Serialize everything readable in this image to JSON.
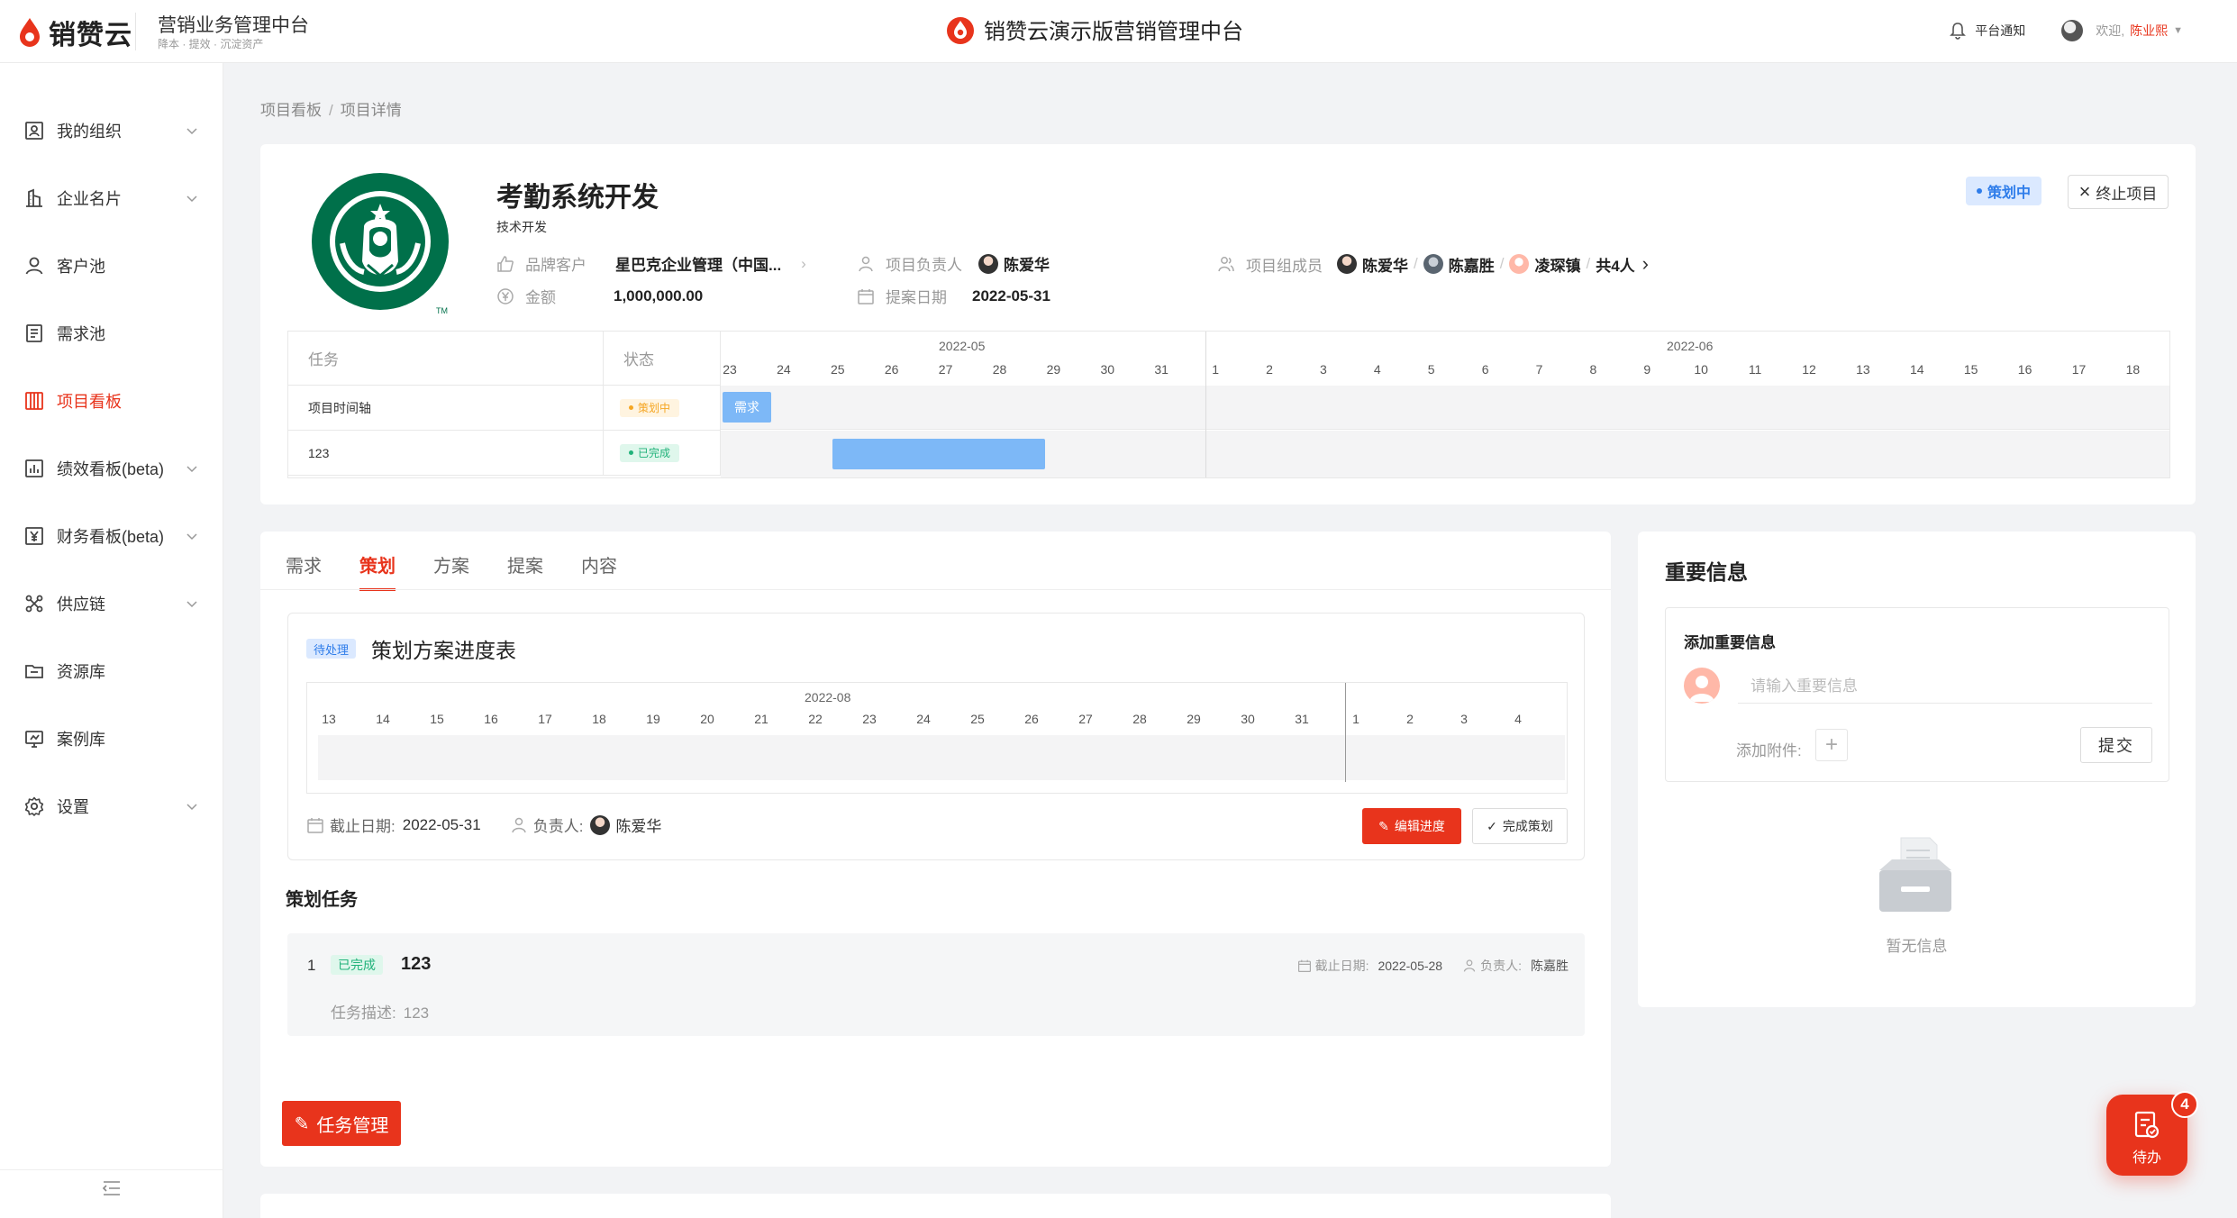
{
  "header": {
    "logo_text": "销赞云",
    "system_title": "营销业务管理中台",
    "system_subtitle": "降本 · 提效 · 沉淀资产",
    "center_title": "销赞云演示版营销管理中台",
    "notify_label": "平台通知",
    "welcome": "欢迎,",
    "user_name": "陈业熙"
  },
  "sidebar": {
    "items": [
      {
        "label": "我的组织",
        "icon": "org-icon",
        "chevron": true
      },
      {
        "label": "企业名片",
        "icon": "building-icon",
        "chevron": true
      },
      {
        "label": "客户池",
        "icon": "user-icon",
        "chevron": false
      },
      {
        "label": "需求池",
        "icon": "doc-icon",
        "chevron": false
      },
      {
        "label": "项目看板",
        "icon": "board-icon",
        "chevron": false,
        "active": true
      },
      {
        "label": "绩效看板(beta)",
        "icon": "chart-icon",
        "chevron": true
      },
      {
        "label": "财务看板(beta)",
        "icon": "yen-icon",
        "chevron": true
      },
      {
        "label": "供应链",
        "icon": "network-icon",
        "chevron": true
      },
      {
        "label": "资源库",
        "icon": "folder-icon",
        "chevron": false
      },
      {
        "label": "案例库",
        "icon": "screen-icon",
        "chevron": false
      },
      {
        "label": "设置",
        "icon": "gear-icon",
        "chevron": true
      }
    ]
  },
  "breadcrumb": {
    "items": [
      "项目看板",
      "项目详情"
    ],
    "separator": "/"
  },
  "project": {
    "name": "考勤系统开发",
    "category": "技术开发",
    "status": "策划中",
    "stop_label": "终止项目",
    "brand_label": "品牌客户",
    "brand_value": "星巴克企业管理（中国...",
    "amount_label": "金额",
    "amount_value": "1,000,000.00",
    "owner_label": "项目负责人",
    "owner_value": "陈爱华",
    "date_label": "提案日期",
    "date_value": "2022-05-31",
    "members_label": "项目组成员",
    "members": [
      "陈爱华",
      "陈嘉胜",
      "凌琛镇"
    ],
    "members_total": "共4人"
  },
  "gantt": {
    "col_task": "任务",
    "col_status": "状态",
    "months": [
      "2022-05",
      "2022-06"
    ],
    "days": [
      "23",
      "24",
      "25",
      "26",
      "27",
      "28",
      "29",
      "30",
      "31",
      "1",
      "2",
      "3",
      "4",
      "5",
      "6",
      "7",
      "8",
      "9",
      "10",
      "11",
      "12",
      "13",
      "14",
      "15",
      "16",
      "17",
      "18"
    ],
    "rows": [
      {
        "task": "项目时间轴",
        "status": "策划中",
        "status_type": "orange",
        "bar_label": "需求"
      },
      {
        "task": "123",
        "status": "已完成",
        "status_type": "green"
      }
    ]
  },
  "tabs": [
    "需求",
    "策划",
    "方案",
    "提案",
    "内容"
  ],
  "plan": {
    "badge": "待处理",
    "title": "策划方案进度表",
    "month": "2022-08",
    "days": [
      "13",
      "14",
      "15",
      "16",
      "17",
      "18",
      "19",
      "20",
      "21",
      "22",
      "23",
      "24",
      "25",
      "26",
      "27",
      "28",
      "29",
      "30",
      "31",
      "1",
      "2",
      "3",
      "4"
    ],
    "deadline_label": "截止日期:",
    "deadline_value": "2022-05-31",
    "owner_label": "负责人:",
    "owner_value": "陈爱华",
    "edit_label": "编辑进度",
    "done_label": "完成策划"
  },
  "tasks": {
    "section_title": "策划任务",
    "items": [
      {
        "index": "1",
        "status": "已完成",
        "name": "123",
        "deadline_label": "截止日期:",
        "deadline": "2022-05-28",
        "owner_label": "负责人:",
        "owner": "陈嘉胜",
        "desc_label": "任务描述:",
        "desc": "123"
      }
    ],
    "manage_label": "任务管理"
  },
  "info": {
    "title": "重要信息",
    "add_title": "添加重要信息",
    "placeholder": "请输入重要信息",
    "attach_label": "添加附件:",
    "submit_label": "提交",
    "empty_text": "暂无信息"
  },
  "todo": {
    "label": "待办",
    "count": "4"
  },
  "colors": {
    "accent": "#e8341c",
    "blue": "#2f7dea",
    "bar": "#7db8f7",
    "green": "#21b27a",
    "orange": "#f5a623"
  }
}
